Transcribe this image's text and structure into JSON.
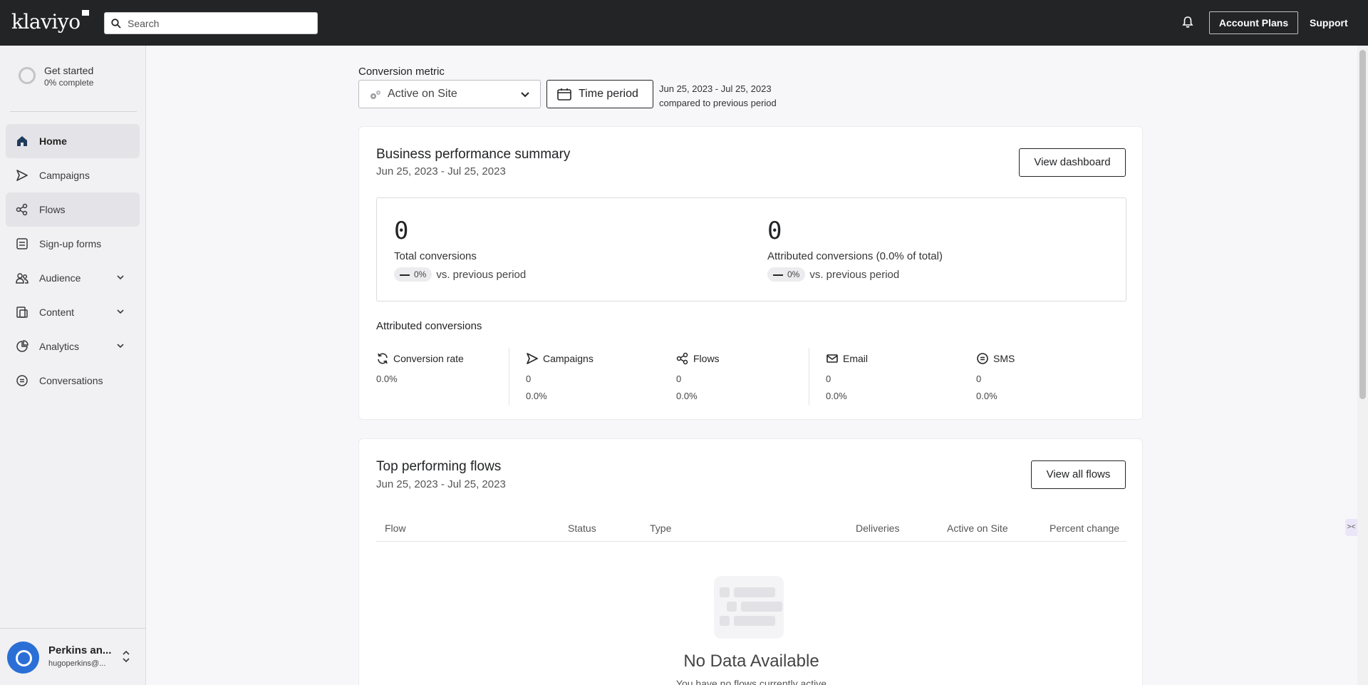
{
  "topbar": {
    "logo_text": "klaviyo",
    "search_placeholder": "Search",
    "account_plans_label": "Account Plans",
    "support_label": "Support"
  },
  "sidebar": {
    "get_started": {
      "title": "Get started",
      "progress": "0% complete"
    },
    "items": [
      {
        "label": "Home",
        "icon": "home-icon",
        "active": true
      },
      {
        "label": "Campaigns",
        "icon": "send-icon"
      },
      {
        "label": "Flows",
        "icon": "flows-icon",
        "highlighted": true
      },
      {
        "label": "Sign-up forms",
        "icon": "form-icon"
      },
      {
        "label": "Audience",
        "icon": "audience-icon",
        "expandable": true
      },
      {
        "label": "Content",
        "icon": "content-icon",
        "expandable": true
      },
      {
        "label": "Analytics",
        "icon": "analytics-icon",
        "expandable": true
      },
      {
        "label": "Conversations",
        "icon": "chat-icon"
      }
    ],
    "account": {
      "name": "Perkins an...",
      "email": "hugoperkins@..."
    }
  },
  "filters": {
    "conversion_metric_label": "Conversion metric",
    "metric_value": "Active on Site",
    "time_period_label": "Time period",
    "date_range": "Jun 25, 2023 - Jul 25, 2023",
    "comparison": "compared to previous period"
  },
  "summary_card": {
    "title": "Business performance summary",
    "date_range": "Jun 25, 2023 - Jul 25, 2023",
    "view_button": "View dashboard",
    "total": {
      "value": "0",
      "label": "Total conversions",
      "change": "0%",
      "vs": "vs. previous period"
    },
    "attributed": {
      "value": "0",
      "label": "Attributed conversions (0.0% of total)",
      "change": "0%",
      "vs": "vs. previous period"
    },
    "attributed_title": "Attributed conversions",
    "stats": [
      {
        "label": "Conversion rate",
        "icon": "refresh-icon",
        "v1": "0.0%",
        "v2": ""
      },
      {
        "label": "Campaigns",
        "icon": "send-icon",
        "v1": "0",
        "v2": "0.0%"
      },
      {
        "label": "Flows",
        "icon": "flows-icon",
        "v1": "0",
        "v2": "0.0%"
      },
      {
        "label": "Email",
        "icon": "mail-icon",
        "v1": "0",
        "v2": "0.0%"
      },
      {
        "label": "SMS",
        "icon": "sms-icon",
        "v1": "0",
        "v2": "0.0%"
      }
    ]
  },
  "flows_card": {
    "title": "Top performing flows",
    "date_range": "Jun 25, 2023 - Jul 25, 2023",
    "view_button": "View all flows",
    "columns": [
      "Flow",
      "Status",
      "Type",
      "Deliveries",
      "Active on Site",
      "Percent change"
    ],
    "empty_title": "No Data Available",
    "empty_sub": "You have no flows currently active"
  }
}
